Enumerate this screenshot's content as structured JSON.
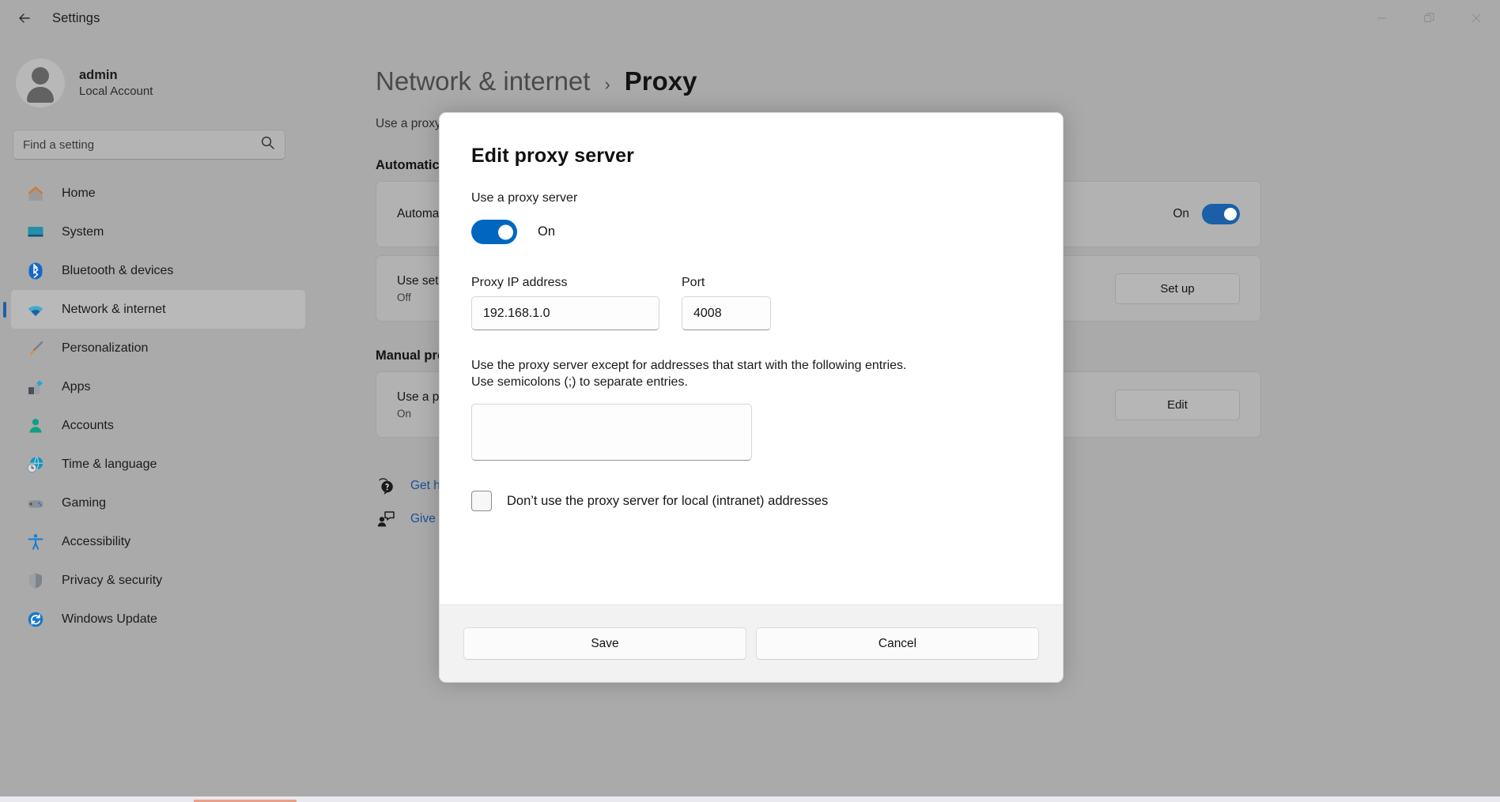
{
  "window": {
    "title": "Settings",
    "back_icon": "back-arrow-icon",
    "controls": [
      {
        "name": "minimize-button",
        "glyph": "minimize-icon"
      },
      {
        "name": "maximize-button",
        "glyph": "restore-icon"
      },
      {
        "name": "close-button",
        "glyph": "close-icon"
      }
    ]
  },
  "sidebar": {
    "account": {
      "name": "admin",
      "type": "Local Account",
      "avatar_icon": "user-avatar-icon"
    },
    "search": {
      "placeholder": "Find a setting",
      "icon": "search-icon"
    },
    "items": [
      {
        "label": "Home",
        "icon": "home-icon",
        "selected": false
      },
      {
        "label": "System",
        "icon": "system-icon",
        "selected": false
      },
      {
        "label": "Bluetooth & devices",
        "icon": "bluetooth-icon",
        "selected": false
      },
      {
        "label": "Network & internet",
        "icon": "wifi-icon",
        "selected": true
      },
      {
        "label": "Personalization",
        "icon": "paintbrush-icon",
        "selected": false
      },
      {
        "label": "Apps",
        "icon": "apps-icon",
        "selected": false
      },
      {
        "label": "Accounts",
        "icon": "accounts-icon",
        "selected": false
      },
      {
        "label": "Time & language",
        "icon": "clock-globe-icon",
        "selected": false
      },
      {
        "label": "Gaming",
        "icon": "gamepad-icon",
        "selected": false
      },
      {
        "label": "Accessibility",
        "icon": "accessibility-icon",
        "selected": false
      },
      {
        "label": "Privacy & security",
        "icon": "shield-icon",
        "selected": false
      },
      {
        "label": "Windows Update",
        "icon": "update-icon",
        "selected": false
      }
    ]
  },
  "page": {
    "breadcrumb_root": "Network & internet",
    "breadcrumb_separator": "›",
    "breadcrumb_leaf": "Proxy",
    "description": "Use a proxy server for Ethernet or Wi-Fi connections.",
    "sections": [
      {
        "heading": "Automatic proxy setup",
        "cards": [
          {
            "title": "Automatically detect settings",
            "sub": "",
            "state_label": "On",
            "control": "toggle",
            "toggle_on": true,
            "button_label": ""
          },
          {
            "title": "Use setup script",
            "sub": "Off",
            "state_label": "",
            "control": "button",
            "toggle_on": false,
            "button_label": "Set up"
          }
        ]
      },
      {
        "heading": "Manual proxy setup",
        "cards": [
          {
            "title": "Use a proxy server",
            "sub": "On",
            "state_label": "",
            "control": "button",
            "toggle_on": false,
            "button_label": "Edit"
          }
        ]
      }
    ],
    "links": [
      {
        "label": "Get help",
        "icon": "help-icon"
      },
      {
        "label": "Give feedback",
        "icon": "feedback-icon"
      }
    ]
  },
  "dialog": {
    "title": "Edit proxy server",
    "use_proxy_label": "Use a proxy server",
    "toggle_state": "On",
    "toggle_on": true,
    "ip_label": "Proxy IP address",
    "ip_value": "192.168.1.0",
    "port_label": "Port",
    "port_value": "4008",
    "exceptions_desc_line1": "Use the proxy server except for addresses that start with the following entries.",
    "exceptions_desc_line2": "Use semicolons (;) to separate entries.",
    "exceptions_value": "",
    "local_checkbox_label": "Don’t use the proxy server for local (intranet) addresses",
    "local_checkbox_checked": false,
    "save_label": "Save",
    "cancel_label": "Cancel"
  },
  "colors": {
    "accent_blue": "#0067C0",
    "dim_page": "#AAAAAA",
    "selected_nav": "#B9B9B9",
    "link_blue": "#1D4F91",
    "footer_gray": "#F2F2F2"
  }
}
